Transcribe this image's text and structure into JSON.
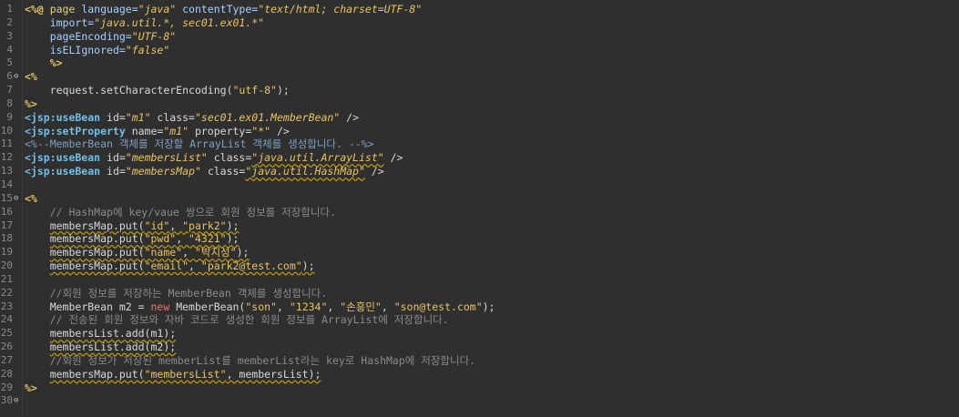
{
  "editor": {
    "lines": [
      {
        "n": "1",
        "fold": "",
        "segs": [
          [
            "jsp",
            "<%@ "
          ],
          [
            "dir",
            "page "
          ],
          [
            "attr",
            "language="
          ],
          [
            "val",
            "\"java\""
          ],
          [
            "attr",
            " contentType="
          ],
          [
            "val",
            "\"text/html; charset=UTF-8\""
          ]
        ]
      },
      {
        "n": "2",
        "fold": "",
        "segs": [
          [
            "ws",
            "    "
          ],
          [
            "attr",
            "import="
          ],
          [
            "val",
            "\"java.util.*, sec01.ex01.*\""
          ]
        ]
      },
      {
        "n": "3",
        "fold": "",
        "segs": [
          [
            "ws",
            "    "
          ],
          [
            "attr",
            "pageEncoding="
          ],
          [
            "val",
            "\"UTF-8\""
          ]
        ]
      },
      {
        "n": "4",
        "fold": "",
        "segs": [
          [
            "ws",
            "    "
          ],
          [
            "attr",
            "isELIgnored="
          ],
          [
            "val",
            "\"false\""
          ]
        ]
      },
      {
        "n": "5",
        "fold": "",
        "segs": [
          [
            "ws",
            "    "
          ],
          [
            "jsp",
            "%>"
          ]
        ]
      },
      {
        "n": "6",
        "fold": "⊖",
        "segs": [
          [
            "jsp",
            "<%"
          ]
        ]
      },
      {
        "n": "7",
        "fold": "",
        "segs": [
          [
            "ws",
            "    "
          ],
          [
            "plain",
            "request.setCharacterEncoding("
          ],
          [
            "str",
            "\"utf-8\""
          ],
          [
            "plain",
            ");"
          ]
        ]
      },
      {
        "n": "8",
        "fold": "",
        "segs": [
          [
            "jsp",
            "%>"
          ]
        ]
      },
      {
        "n": "9",
        "fold": "",
        "segs": [
          [
            "tag",
            "<jsp:useBean"
          ],
          [
            "tagattr",
            " id="
          ],
          [
            "val",
            "\"m1\""
          ],
          [
            "tagattr",
            " class="
          ],
          [
            "val",
            "\"sec01.ex01.MemberBean\""
          ],
          [
            "tagattr",
            " />"
          ]
        ]
      },
      {
        "n": "10",
        "fold": "",
        "segs": [
          [
            "tag",
            "<jsp:setProperty"
          ],
          [
            "tagattr",
            " name="
          ],
          [
            "val",
            "\"m1\""
          ],
          [
            "tagattr",
            " property="
          ],
          [
            "val",
            "\"*\""
          ],
          [
            "tagattr",
            " />"
          ]
        ]
      },
      {
        "n": "11",
        "fold": "",
        "segs": [
          [
            "jcmt",
            "<%--MemberBean 객체를 저장할 ArrayList 객체를 생성합니다. --%>"
          ]
        ]
      },
      {
        "n": "12",
        "fold": "",
        "segs": [
          [
            "tag",
            "<jsp:useBean"
          ],
          [
            "tagattr",
            " id="
          ],
          [
            "val",
            "\"membersList\""
          ],
          [
            "tagattr",
            " class="
          ],
          [
            "valw",
            "\"java.util.ArrayList\""
          ],
          [
            "tagattr",
            " />"
          ]
        ]
      },
      {
        "n": "13",
        "fold": "",
        "segs": [
          [
            "tag",
            "<jsp:useBean"
          ],
          [
            "tagattr",
            " id="
          ],
          [
            "val",
            "\"membersMap\""
          ],
          [
            "tagattr",
            " class="
          ],
          [
            "valw",
            "\"java.util.HashMap\""
          ],
          [
            "tagattr",
            " />"
          ]
        ]
      },
      {
        "n": "14",
        "fold": "",
        "segs": []
      },
      {
        "n": "15",
        "fold": "⊖",
        "segs": [
          [
            "jsp",
            "<%"
          ]
        ]
      },
      {
        "n": "16",
        "fold": "",
        "segs": [
          [
            "ws",
            "    "
          ],
          [
            "cmt",
            "// HashMap에 key/vaue 쌍으로 회원 정보를 저장합니다."
          ]
        ]
      },
      {
        "n": "17",
        "fold": "",
        "segs": [
          [
            "ws",
            "    "
          ],
          [
            "plainw",
            "membersMap.put("
          ],
          [
            "strw",
            "\"id\""
          ],
          [
            "plainw",
            ", "
          ],
          [
            "strw",
            "\"park2\""
          ],
          [
            "plainw",
            ");"
          ]
        ]
      },
      {
        "n": "18",
        "fold": "",
        "segs": [
          [
            "ws",
            "    "
          ],
          [
            "plainw",
            "membersMap.put("
          ],
          [
            "strw",
            "\"pwd\""
          ],
          [
            "plainw",
            ", "
          ],
          [
            "strw",
            "\"4321\""
          ],
          [
            "plainw",
            ");"
          ]
        ]
      },
      {
        "n": "19",
        "fold": "",
        "segs": [
          [
            "ws",
            "    "
          ],
          [
            "plainw",
            "membersMap.put("
          ],
          [
            "strw",
            "\"name\""
          ],
          [
            "plainw",
            ", "
          ],
          [
            "strw",
            "\"박지성\""
          ],
          [
            "plainw",
            ");"
          ]
        ]
      },
      {
        "n": "20",
        "fold": "",
        "segs": [
          [
            "ws",
            "    "
          ],
          [
            "plainw",
            "membersMap.put("
          ],
          [
            "strw",
            "\"email\""
          ],
          [
            "plainw",
            ", "
          ],
          [
            "strw",
            "\"park2@test.com\""
          ],
          [
            "plainw",
            ");"
          ]
        ]
      },
      {
        "n": "21",
        "fold": "",
        "segs": []
      },
      {
        "n": "22",
        "fold": "",
        "segs": [
          [
            "ws",
            "    "
          ],
          [
            "cmt",
            "//회원 정보를 저장하는 MemberBean 객체를 생성합니다."
          ]
        ]
      },
      {
        "n": "23",
        "fold": "",
        "segs": [
          [
            "ws",
            "    "
          ],
          [
            "plain",
            "MemberBean m2 = "
          ],
          [
            "kw",
            "new"
          ],
          [
            "plain",
            " MemberBean("
          ],
          [
            "str",
            "\"son\""
          ],
          [
            "plain",
            ", "
          ],
          [
            "str",
            "\"1234\""
          ],
          [
            "plain",
            ", "
          ],
          [
            "str",
            "\"손흥민\""
          ],
          [
            "plain",
            ", "
          ],
          [
            "str",
            "\"son@test.com\""
          ],
          [
            "plain",
            ");"
          ]
        ]
      },
      {
        "n": "24",
        "fold": "",
        "segs": [
          [
            "ws",
            "    "
          ],
          [
            "cmt",
            "// 전송된 회원 정보와 자바 코드로 생성한 회원 정보를 ArrayList에 저장합니다."
          ]
        ]
      },
      {
        "n": "25",
        "fold": "",
        "segs": [
          [
            "ws",
            "    "
          ],
          [
            "plainw",
            "membersList.add(m1);"
          ]
        ]
      },
      {
        "n": "26",
        "fold": "",
        "segs": [
          [
            "ws",
            "    "
          ],
          [
            "plainw",
            "membersList.add(m2);"
          ]
        ]
      },
      {
        "n": "27",
        "fold": "",
        "segs": [
          [
            "ws",
            "    "
          ],
          [
            "cmt",
            "//회원 정보가 저장된 memberList를 memberList라는 key로 HashMap에 저장합니다."
          ]
        ]
      },
      {
        "n": "28",
        "fold": "",
        "segs": [
          [
            "ws",
            "    "
          ],
          [
            "plainw",
            "membersMap.put("
          ],
          [
            "strw",
            "\"membersList\""
          ],
          [
            "plainw",
            ", membersList);"
          ]
        ]
      },
      {
        "n": "29",
        "fold": "",
        "segs": [
          [
            "jsp",
            "%>"
          ]
        ]
      },
      {
        "n": "30",
        "fold": "⊖",
        "segs": []
      }
    ]
  }
}
